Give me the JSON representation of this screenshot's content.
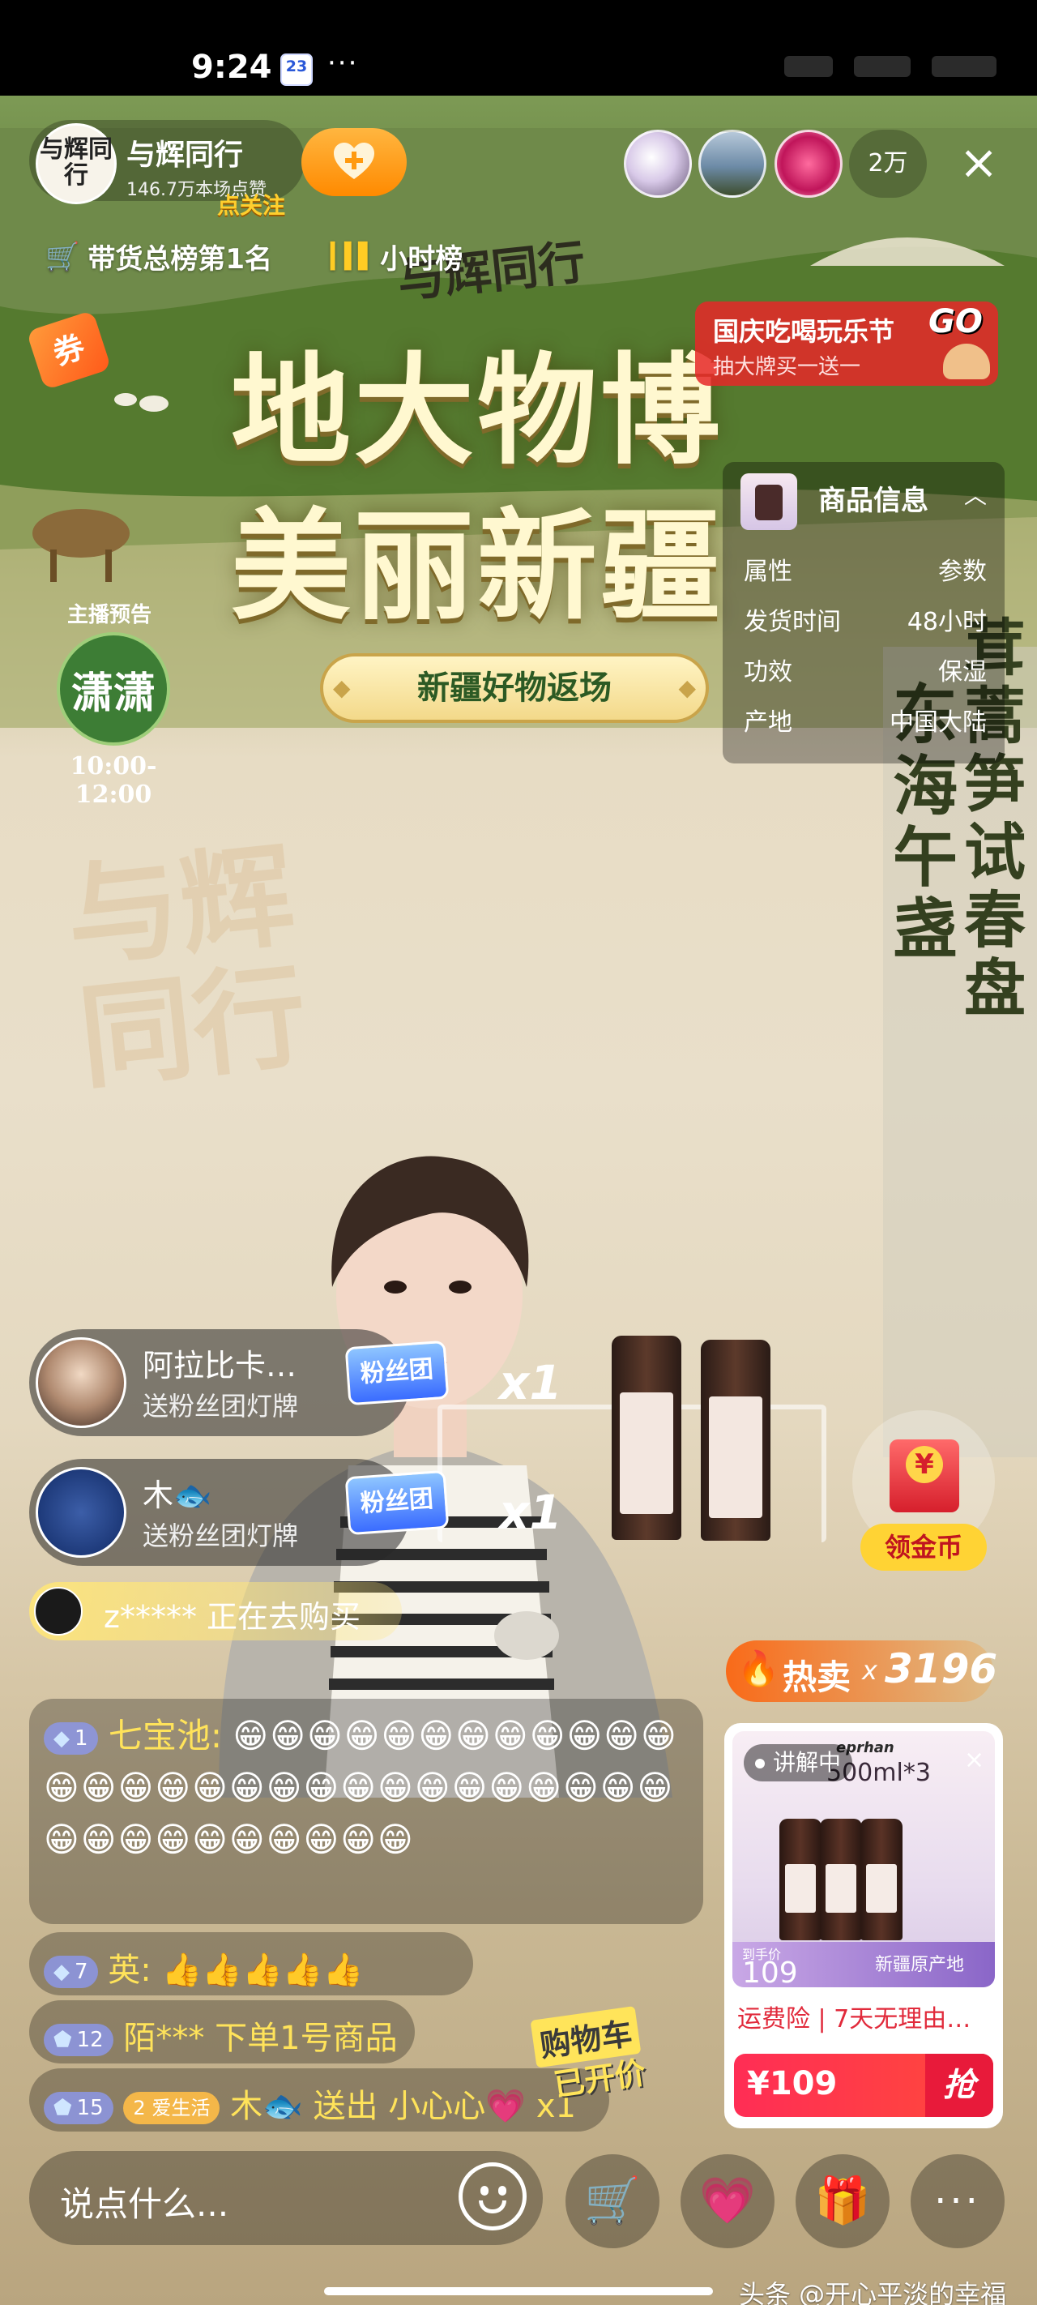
{
  "status_bar": {
    "time": "9:24",
    "calendar_day": "23",
    "more": "···"
  },
  "stream_scene": {
    "brand_script": "与辉同行",
    "title_line1": "地大物博",
    "title_line2": "美丽新疆",
    "banner": "新疆好物返场",
    "preview_label": "主播预告",
    "preview_name": "潇潇",
    "preview_hours": "10:00-12:00",
    "wall_brand": "与辉同行",
    "right_banner_col1": "东海午盏",
    "right_banner_col2": "茸蒿笋试春盘"
  },
  "top_bar": {
    "host_avatar_text": "与辉同行",
    "host_name": "与辉同行",
    "host_likes": "146.7万本场点赞",
    "follow_ribbon": "点关注",
    "viewer_count": "2万",
    "close": "×"
  },
  "rank": {
    "sales_rank": "带货总榜第1名",
    "hour_rank": "小时榜"
  },
  "coupon_label": "券",
  "festival": {
    "title": "国庆吃喝玩乐节",
    "subtitle": "抽大牌买一送一",
    "go": "GO"
  },
  "product_info": {
    "title": "商品信息",
    "rows": [
      {
        "k": "属性",
        "v": "参数"
      },
      {
        "k": "发货时间",
        "v": "48小时"
      },
      {
        "k": "功效",
        "v": "保湿"
      },
      {
        "k": "产地",
        "v": "中国大陆"
      }
    ]
  },
  "gifts": [
    {
      "name": "阿拉比卡…",
      "action": "送粉丝团灯牌",
      "badge": "粉丝团",
      "count": "x1"
    },
    {
      "name": "木🐟",
      "action": "送粉丝团灯牌",
      "badge": "粉丝团",
      "count": "x1"
    }
  ],
  "buying": {
    "user": "z*****",
    "text": "正在去购买"
  },
  "hot_sale": {
    "label": "热卖",
    "x": "x",
    "count": "3196"
  },
  "coin_label": "领金币",
  "chat": {
    "big": {
      "level": "1",
      "user": "七宝池:",
      "emojis": "😁😁😁😁😁😁😁😁😁😁😁😁😁😁😁😁😁😁😁😁😁😁😁😁😁😁😁😁😁😁😁😁😁😁😁😁😁😁😁"
    },
    "line2": {
      "level": "7",
      "user": "英:",
      "text": "👍👍👍👍👍"
    },
    "line3": {
      "level": "12",
      "user": "陌***",
      "text": "下单1号商品"
    },
    "line4": {
      "level": "15",
      "fan_level": "2",
      "fan_name": "爱生活",
      "user": "木🐟",
      "text": "送出 小心心💗 x1"
    }
  },
  "cart_sticker": {
    "line1": "购物车",
    "line2": "已开价"
  },
  "product_card": {
    "live_label": "讲解中",
    "close": "×",
    "brand": "eprhan",
    "spec": "500ml*3",
    "price_tag": "到手价",
    "price_value": "109",
    "origin": "新疆原产地",
    "desc": "运费险 | 7天无理由…",
    "price": "¥109",
    "buy": "抢"
  },
  "bottom_bar": {
    "placeholder": "说点什么...",
    "more": "···"
  },
  "watermark": "头条 @开心平淡的幸福"
}
